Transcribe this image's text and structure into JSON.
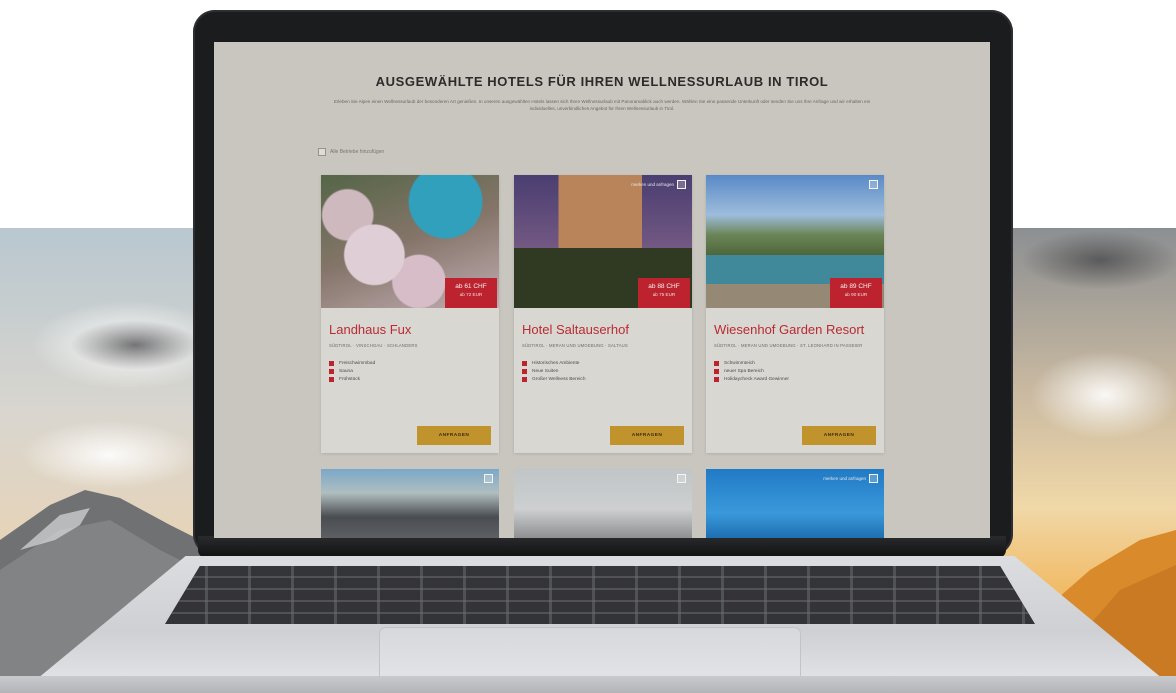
{
  "page": {
    "title": "AUSGEWÄHLTE HOTELS FÜR IHREN WELLNESSURLAUB IN TIROL",
    "intro": "Erleben Sie Alpen einen Wellnessurlaub der besonderen Art genießen. In unseren ausgewählten Hotels lassen sich Ihren Wellnessurlaub mit Panoramablick auch werden. Wählen Sie eine passende Unterkunft oder senden Sie uns Ihre Anfrage und wir erhalten ein individuelles, unverbindliches Angebot für Ihren Wellnessurlaub in Tirol.",
    "select_all_label": "Alle Betriebe hinzufügen",
    "add_to_request_label": "merken und anfragen"
  },
  "hotels": [
    {
      "name": "Landhaus Fux",
      "location": "SÜDTIROL · VINSCHGAU · SCHLANDERS",
      "price": "ab 61 CHF",
      "price_sub": "ab 72 EUR",
      "features": [
        "Freischwimmbad",
        "Sauna",
        "Frühstück"
      ],
      "button": "ANFRAGEN"
    },
    {
      "name": "Hotel Saltauserhof",
      "location": "SÜDTIROL · MERAN UND UMGEBUNG · SALTAUS",
      "price": "ab 88 CHF",
      "price_sub": "ab 75 EUR",
      "features": [
        "Historisches Ambiente",
        "Neue Suiten",
        "Großer Wellness Bereich"
      ],
      "button": "ANFRAGEN"
    },
    {
      "name": "Wiesenhof Garden Resort",
      "location": "SÜDTIROL · MERAN UND UMGEBUNG · ST. LEONHARD IN PASSEIER",
      "price": "ab 89 CHF",
      "price_sub": "ab 90 EUR",
      "features": [
        "Schwimmteich",
        "neuer Spa Bereich",
        "Holidaycheck Award Gewinner"
      ],
      "button": "ANFRAGEN"
    }
  ],
  "colors": {
    "accent_red": "#c52230",
    "title_red": "#c22a35",
    "button_gold": "#c99a2e",
    "page_bg": "#d2d0ca"
  }
}
